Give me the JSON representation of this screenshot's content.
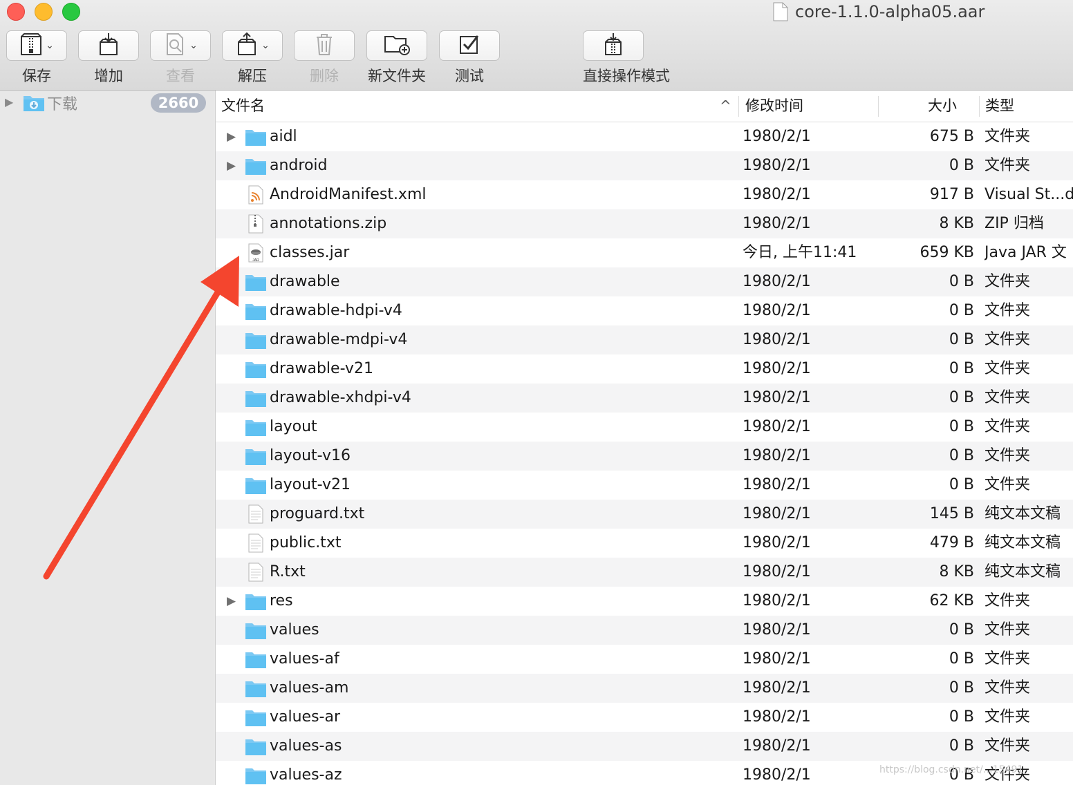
{
  "window": {
    "title": "core-1.1.0-alpha05.aar"
  },
  "toolbar": [
    {
      "label": "保存",
      "icon": "archive-save-icon",
      "has_menu": true,
      "enabled": true
    },
    {
      "label": "增加",
      "icon": "add-files-icon",
      "has_menu": false,
      "enabled": true
    },
    {
      "label": "查看",
      "icon": "view-icon",
      "has_menu": true,
      "enabled": false
    },
    {
      "label": "解压",
      "icon": "extract-icon",
      "has_menu": true,
      "enabled": true
    },
    {
      "label": "删除",
      "icon": "trash-icon",
      "has_menu": false,
      "enabled": false
    },
    {
      "label": "新文件夹",
      "icon": "new-folder-icon",
      "has_menu": false,
      "enabled": true
    },
    {
      "label": "测试",
      "icon": "checkmark-icon",
      "has_menu": false,
      "enabled": true
    },
    {
      "label": "直接操作模式",
      "icon": "direct-mode-icon",
      "has_menu": false,
      "enabled": true
    }
  ],
  "sidebar": {
    "item_label": "下载",
    "item_icon": "downloads-folder-icon",
    "badge": "2660"
  },
  "columns": {
    "name": "文件名",
    "modified": "修改时间",
    "size": "大小",
    "kind": "类型",
    "sort_indicator": "^"
  },
  "files": [
    {
      "name": "aidl",
      "date": "1980/2/1",
      "size": "675 B",
      "kind": "文件夹",
      "icon": "folder-icon",
      "expandable": true
    },
    {
      "name": "android",
      "date": "1980/2/1",
      "size": "0 B",
      "kind": "文件夹",
      "icon": "folder-icon",
      "expandable": true
    },
    {
      "name": "AndroidManifest.xml",
      "date": "1980/2/1",
      "size": "917 B",
      "kind": "Visual St...d",
      "icon": "xml-file-icon",
      "expandable": false
    },
    {
      "name": "annotations.zip",
      "date": "1980/2/1",
      "size": "8 KB",
      "kind": "ZIP 归档",
      "icon": "zip-file-icon",
      "expandable": false
    },
    {
      "name": "classes.jar",
      "date": "今日, 上午11:41",
      "size": "659 KB",
      "kind": "Java JAR 文",
      "icon": "jar-file-icon",
      "expandable": false
    },
    {
      "name": "drawable",
      "date": "1980/2/1",
      "size": "0 B",
      "kind": "文件夹",
      "icon": "folder-icon",
      "expandable": false
    },
    {
      "name": "drawable-hdpi-v4",
      "date": "1980/2/1",
      "size": "0 B",
      "kind": "文件夹",
      "icon": "folder-icon",
      "expandable": false
    },
    {
      "name": "drawable-mdpi-v4",
      "date": "1980/2/1",
      "size": "0 B",
      "kind": "文件夹",
      "icon": "folder-icon",
      "expandable": false
    },
    {
      "name": "drawable-v21",
      "date": "1980/2/1",
      "size": "0 B",
      "kind": "文件夹",
      "icon": "folder-icon",
      "expandable": false
    },
    {
      "name": "drawable-xhdpi-v4",
      "date": "1980/2/1",
      "size": "0 B",
      "kind": "文件夹",
      "icon": "folder-icon",
      "expandable": false
    },
    {
      "name": "layout",
      "date": "1980/2/1",
      "size": "0 B",
      "kind": "文件夹",
      "icon": "folder-icon",
      "expandable": false
    },
    {
      "name": "layout-v16",
      "date": "1980/2/1",
      "size": "0 B",
      "kind": "文件夹",
      "icon": "folder-icon",
      "expandable": false
    },
    {
      "name": "layout-v21",
      "date": "1980/2/1",
      "size": "0 B",
      "kind": "文件夹",
      "icon": "folder-icon",
      "expandable": false
    },
    {
      "name": "proguard.txt",
      "date": "1980/2/1",
      "size": "145 B",
      "kind": "纯文本文稿",
      "icon": "text-file-icon",
      "expandable": false
    },
    {
      "name": "public.txt",
      "date": "1980/2/1",
      "size": "479 B",
      "kind": "纯文本文稿",
      "icon": "text-file-icon",
      "expandable": false
    },
    {
      "name": "R.txt",
      "date": "1980/2/1",
      "size": "8 KB",
      "kind": "纯文本文稿",
      "icon": "text-file-icon",
      "expandable": false
    },
    {
      "name": "res",
      "date": "1980/2/1",
      "size": "62 KB",
      "kind": "文件夹",
      "icon": "folder-icon",
      "expandable": true
    },
    {
      "name": "values",
      "date": "1980/2/1",
      "size": "0 B",
      "kind": "文件夹",
      "icon": "folder-icon",
      "expandable": false
    },
    {
      "name": "values-af",
      "date": "1980/2/1",
      "size": "0 B",
      "kind": "文件夹",
      "icon": "folder-icon",
      "expandable": false
    },
    {
      "name": "values-am",
      "date": "1980/2/1",
      "size": "0 B",
      "kind": "文件夹",
      "icon": "folder-icon",
      "expandable": false
    },
    {
      "name": "values-ar",
      "date": "1980/2/1",
      "size": "0 B",
      "kind": "文件夹",
      "icon": "folder-icon",
      "expandable": false
    },
    {
      "name": "values-as",
      "date": "1980/2/1",
      "size": "0 B",
      "kind": "文件夹",
      "icon": "folder-icon",
      "expandable": false
    },
    {
      "name": "values-az",
      "date": "1980/2/1",
      "size": "0 B",
      "kind": "文件夹",
      "icon": "folder-icon",
      "expandable": false
    }
  ],
  "annotation": {
    "type": "arrow",
    "color": "#f4452e",
    "points_to": "classes.jar"
  },
  "watermark": "https://blog.csdn.net/…15491",
  "colors": {
    "folder": "#5fc1f2",
    "arrow": "#f4452e",
    "badge": "#b1b8c5",
    "row_alt": "#f4f4f5"
  }
}
